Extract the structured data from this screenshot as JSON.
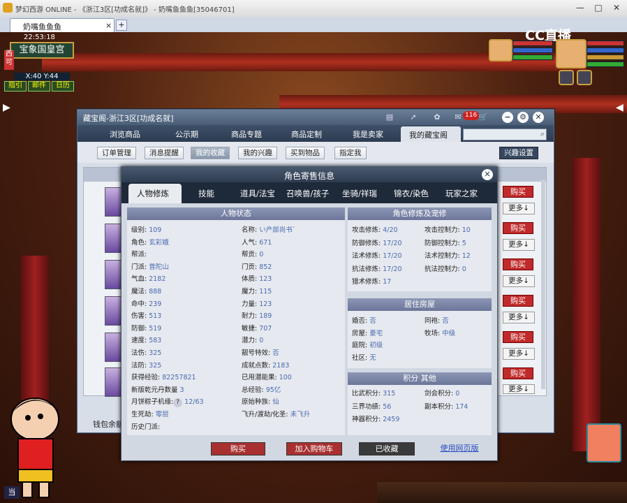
{
  "window": {
    "title": "梦幻西游 ONLINE - 《浙江3区[功成名就]》 - 奶嘴鱼鱼鱼[35046701]",
    "tab_label": "奶嘴鱼鱼鱼",
    "tab_close": "×",
    "tab_add": "+",
    "min": "—",
    "max": "□",
    "close": "✕"
  },
  "game": {
    "clock": "22:53:18",
    "location": "宝象国皇宫",
    "west_label": "西可",
    "coords": "X:40 Y:44",
    "map_buttons": [
      "指引",
      "邮件",
      "日历"
    ],
    "stream_logo": "CC直播",
    "bottom_left": "当"
  },
  "market": {
    "title": "藏宝阁-浙江3区[功成名就]",
    "cart_count": "116",
    "nav": [
      "浏览商品",
      "公示期",
      "商品专题",
      "商品定制",
      "我是卖家",
      "我的藏宝阁"
    ],
    "subnav": [
      "订单管理",
      "消息提醒",
      "我的收藏",
      "我的兴趣",
      "买到物品",
      "指定我"
    ],
    "interest_settings": "兴趣设置",
    "buy_label": "购买",
    "more_label": "更多↓",
    "wallet": "钱包余额",
    "search_placeholder": ""
  },
  "detail": {
    "title": "角色寄售信息",
    "close": "✕",
    "tabs": [
      "人物修炼",
      "技能",
      "道具/法宝",
      "召唤兽/孩子",
      "坐骑/祥瑞",
      "锦衣/染色",
      "玩家之家"
    ],
    "status_header": "人物状态",
    "left_col": [
      {
        "k": "级别:",
        "v": "109"
      },
      {
        "k": "角色:",
        "v": "玄彩娥"
      },
      {
        "k": "帮派:",
        "v": ""
      },
      {
        "k": "门派:",
        "v": "普陀山"
      },
      {
        "k": "气血:",
        "v": "2182"
      },
      {
        "k": "魔法:",
        "v": "888"
      },
      {
        "k": "命中:",
        "v": "239"
      },
      {
        "k": "伤害:",
        "v": "513"
      },
      {
        "k": "防御:",
        "v": "519"
      },
      {
        "k": "速度:",
        "v": "583"
      },
      {
        "k": "法伤:",
        "v": "325"
      },
      {
        "k": "法防:",
        "v": "325"
      },
      {
        "k": "获得经验:",
        "v": "82257821"
      },
      {
        "k": "新版乾元丹数量",
        "v": "3"
      },
      {
        "k": "月饼粽子机缘:",
        "v": "12/63"
      },
      {
        "k": "生死劫:",
        "v": "零层"
      },
      {
        "k": "历史门派:",
        "v": ""
      }
    ],
    "mid_col": [
      {
        "k": "名称:",
        "v": "い产部尚书`"
      },
      {
        "k": "人气:",
        "v": "671"
      },
      {
        "k": "帮贡:",
        "v": "0"
      },
      {
        "k": "门贡:",
        "v": "852"
      },
      {
        "k": "体质:",
        "v": "123"
      },
      {
        "k": "魔力:",
        "v": "115"
      },
      {
        "k": "力量:",
        "v": "123"
      },
      {
        "k": "耐力:",
        "v": "189"
      },
      {
        "k": "敏捷:",
        "v": "707"
      },
      {
        "k": "潜力:",
        "v": "0"
      },
      {
        "k": "靓号特效:",
        "v": "否"
      },
      {
        "k": "成就点数:",
        "v": "2183"
      },
      {
        "k": "已用潜能果:",
        "v": "100"
      },
      {
        "k": "总经验:",
        "v": "95亿"
      },
      {
        "k": "原始种族:",
        "v": "仙"
      },
      {
        "k": "飞升/渡劫/化圣:",
        "v": "未飞升"
      }
    ],
    "cultivation_header": "角色修炼及宠修",
    "cultivation": [
      {
        "k": "攻击修炼:",
        "v": "4/20",
        "k2": "攻击控制力:",
        "v2": "10"
      },
      {
        "k": "防御修炼:",
        "v": "17/20",
        "k2": "防御控制力:",
        "v2": "5"
      },
      {
        "k": "法术修炼:",
        "v": "17/20",
        "k2": "法术控制力:",
        "v2": "12"
      },
      {
        "k": "抗法修炼:",
        "v": "17/20",
        "k2": "抗法控制力:",
        "v2": "0"
      },
      {
        "k": "猎术修炼:",
        "v": "17",
        "k2": "",
        "v2": ""
      }
    ],
    "residence_header": "居住房屋",
    "residence": [
      {
        "k": "婚否:",
        "v": "否",
        "k2": "同袍:",
        "v2": "否"
      },
      {
        "k": "房屋:",
        "v": "豪宅",
        "k2": "牧场:",
        "v2": "中级"
      },
      {
        "k": "庭院:",
        "v": "初级",
        "k2": "",
        "v2": ""
      },
      {
        "k": "社区:",
        "v": "无",
        "k2": "",
        "v2": ""
      }
    ],
    "points_header": "积分 其他",
    "points": [
      {
        "k": "比武积分:",
        "v": "315",
        "k2": "剑会积分:",
        "v2": "0"
      },
      {
        "k": "三界功绩:",
        "v": "56",
        "k2": "副本积分:",
        "v2": "174"
      },
      {
        "k": "神器积分:",
        "v": "2459",
        "k2": "",
        "v2": ""
      }
    ],
    "question_mark": "?",
    "buttons": {
      "buy": "购买",
      "add_cart": "加入购物车",
      "collected": "已收藏",
      "web_version": "使用网页版"
    }
  }
}
